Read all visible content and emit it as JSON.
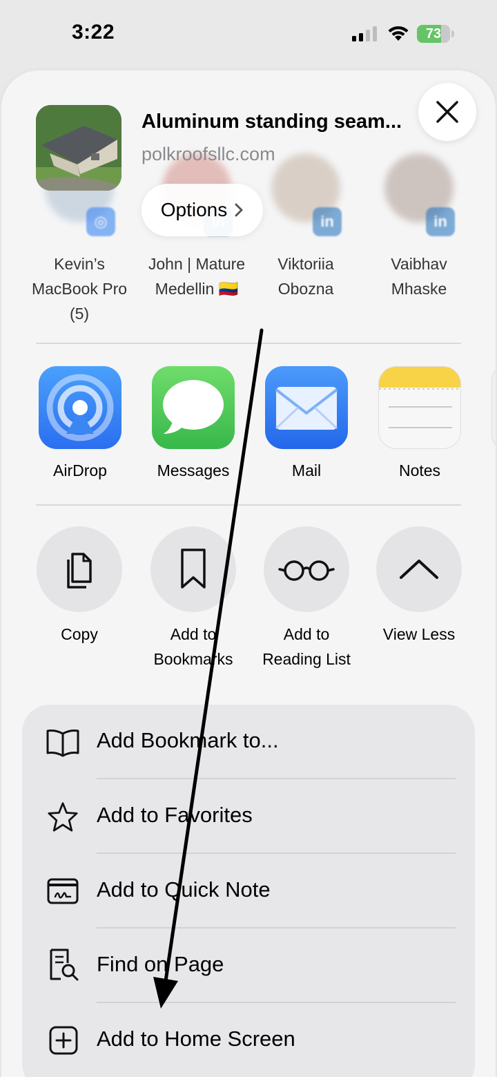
{
  "status_bar": {
    "time": "3:22",
    "battery": "73",
    "battery_level": 0.73,
    "battery_color": "#65c466"
  },
  "share_header": {
    "title": "Aluminum standing seam...",
    "domain": "polkroofsllc.com",
    "options_label": "Options",
    "options_chevron": "chevron-right-icon",
    "close_icon": "close-icon"
  },
  "contacts": [
    {
      "name_line1": "Kevin’s",
      "name_line2": "MacBook Pro",
      "name_line3": "(5)",
      "badge": "airdrop-icon"
    },
    {
      "name_line1": "John | Mature",
      "name_line2": "Medellin 🇨🇴",
      "name_line3": "",
      "badge": "linkedin-icon"
    },
    {
      "name_line1": "Viktoriia",
      "name_line2": "Obozna",
      "name_line3": "",
      "badge": "linkedin-icon"
    },
    {
      "name_line1": "Vaibhav",
      "name_line2": "Mhaske",
      "name_line3": "",
      "badge": "linkedin-icon"
    }
  ],
  "apps": [
    {
      "label": "AirDrop",
      "icon": "airdrop-icon"
    },
    {
      "label": "Messages",
      "icon": "messages-icon"
    },
    {
      "label": "Mail",
      "icon": "mail-icon"
    },
    {
      "label": "Notes",
      "icon": "notes-icon"
    }
  ],
  "actions": [
    {
      "label_line1": "Copy",
      "label_line2": "",
      "icon": "copy-icon"
    },
    {
      "label_line1": "Add to",
      "label_line2": "Bookmarks",
      "icon": "bookmark-icon"
    },
    {
      "label_line1": "Add to",
      "label_line2": "Reading List",
      "icon": "reading-glasses-icon"
    },
    {
      "label_line1": "View Less",
      "label_line2": "",
      "icon": "chevron-up-icon"
    }
  ],
  "menu": [
    {
      "label": "Add Bookmark to...",
      "icon": "book-icon"
    },
    {
      "label": "Add to Favorites",
      "icon": "star-icon"
    },
    {
      "label": "Add to Quick Note",
      "icon": "quick-note-icon"
    },
    {
      "label": "Find on Page",
      "icon": "find-on-page-icon"
    },
    {
      "label": "Add to Home Screen",
      "icon": "add-square-icon"
    }
  ],
  "colors": {
    "airdrop_blue": "#3a86f2",
    "messages_green": "#4fcb5e",
    "mail_blue": "#2f7cf5",
    "notes_yellow": "#f8d247",
    "linkedin_blue": "#2f7ac1"
  }
}
